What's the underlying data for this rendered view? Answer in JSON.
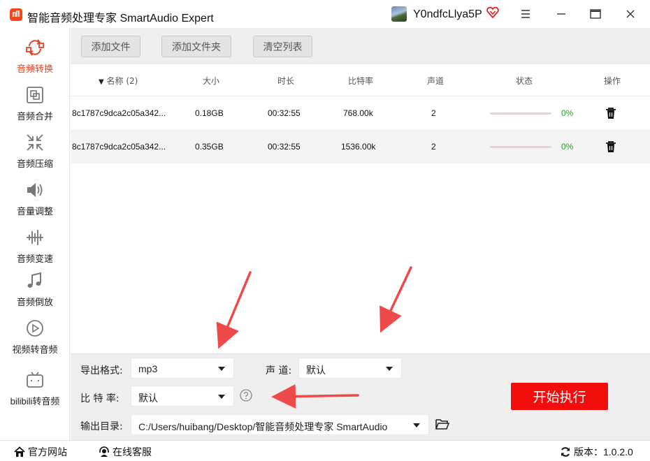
{
  "app": {
    "title": "智能音频处理专家 SmartAudio Expert",
    "username": "Y0ndfcLlya5P",
    "accent": "#e8441f",
    "icons": [
      "app-logo-icon",
      "vip-heart-icon",
      "menu-icon",
      "minimize-icon",
      "maximize-icon",
      "close-icon"
    ]
  },
  "sidebar": {
    "items": [
      {
        "label": "音频转换",
        "icon": "convert-icon",
        "active": true
      },
      {
        "label": "音频合并",
        "icon": "merge-icon",
        "active": false
      },
      {
        "label": "音频压缩",
        "icon": "compress-icon",
        "active": false
      },
      {
        "label": "音量调整",
        "icon": "volume-icon",
        "active": false
      },
      {
        "label": "音频变速",
        "icon": "speed-icon",
        "active": false
      },
      {
        "label": "音频倒放",
        "icon": "music-note-icon",
        "active": false
      },
      {
        "label": "视频转音频",
        "icon": "video-play-icon",
        "active": false
      },
      {
        "label": "bilibili转音频",
        "icon": "bilibili-icon",
        "active": false
      }
    ]
  },
  "toolbar": {
    "add_file": "添加文件",
    "add_folder": "添加文件夹",
    "clear_list": "清空列表"
  },
  "table": {
    "headers": {
      "name": "名称 (2)",
      "size": "大小",
      "duration": "时长",
      "bitrate": "比特率",
      "channels": "声道",
      "status": "状态",
      "action": "操作"
    },
    "rows": [
      {
        "name": "8c1787c9dca2c05a342...",
        "size": "0.18GB",
        "duration": "00:32:55",
        "bitrate": "768.00k",
        "channels": "2",
        "progress": "0%"
      },
      {
        "name": "8c1787c9dca2c05a342...",
        "size": "0.35GB",
        "duration": "00:32:55",
        "bitrate": "1536.00k",
        "channels": "2",
        "progress": "0%"
      }
    ]
  },
  "settings": {
    "format_label": "导出格式:",
    "format_value": "mp3",
    "channel_label": "声 道:",
    "channel_value": "默认",
    "bitrate_label": "比 特 率:",
    "bitrate_value": "默认",
    "output_label": "输出目录:",
    "output_value": "C:/Users/huibang/Desktop/智能音频处理专家 SmartAudio",
    "start_button": "开始执行",
    "start_color": "#f20d0d"
  },
  "statusbar": {
    "website": "官方网站",
    "support": "在线客服",
    "version": "版本：1.0.2.0"
  }
}
